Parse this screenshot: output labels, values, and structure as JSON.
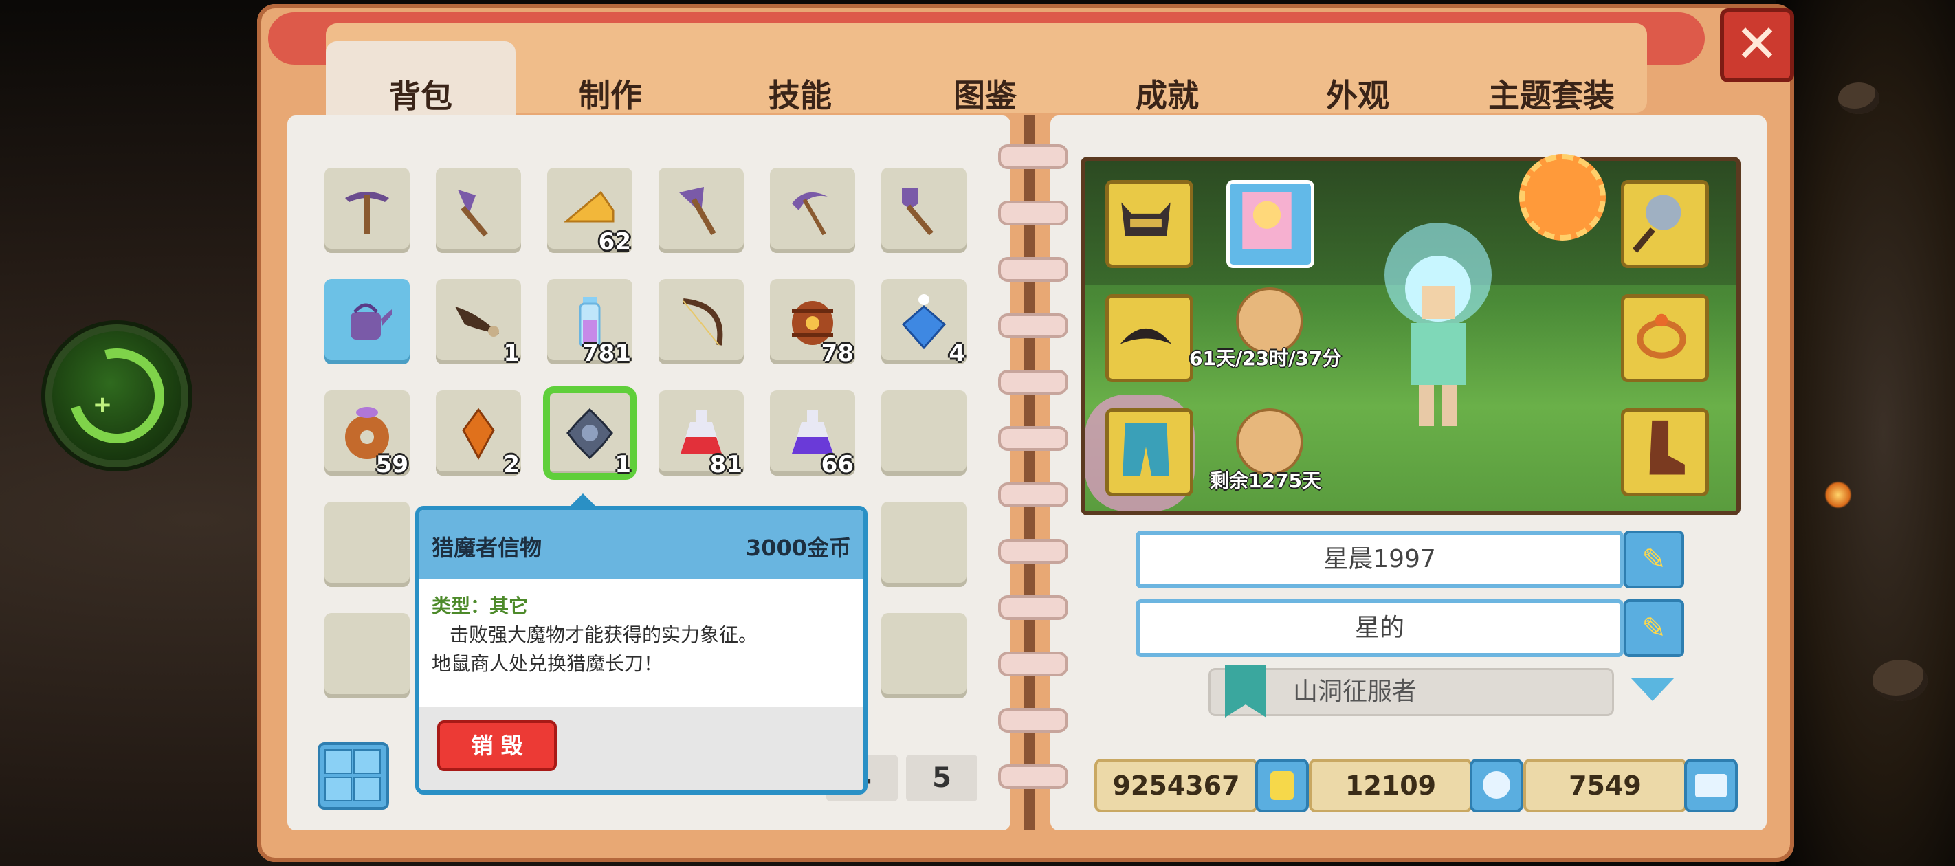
{
  "tabs": [
    "背包",
    "制作",
    "技能",
    "图鉴",
    "成就",
    "外观",
    "主题套装"
  ],
  "active_tab": "背包",
  "inventory": {
    "rows": [
      [
        {
          "icon": "pickaxe-icon",
          "qty": ""
        },
        {
          "icon": "hoe-icon",
          "qty": ""
        },
        {
          "icon": "cheese-icon",
          "qty": "62"
        },
        {
          "icon": "axe-icon",
          "qty": ""
        },
        {
          "icon": "scythe-icon",
          "qty": ""
        },
        {
          "icon": "shovel-icon",
          "qty": ""
        }
      ],
      [
        {
          "icon": "watering-can-icon",
          "qty": ""
        },
        {
          "icon": "bird-icon",
          "qty": "1"
        },
        {
          "icon": "glass-vial-icon",
          "qty": "781"
        },
        {
          "icon": "bow-icon",
          "qty": ""
        },
        {
          "icon": "barrel-icon",
          "qty": "78"
        },
        {
          "icon": "blue-gem-icon",
          "qty": "4"
        }
      ],
      [
        {
          "icon": "donut-icon",
          "qty": "59"
        },
        {
          "icon": "amber-crystal-icon",
          "qty": "2"
        },
        {
          "icon": "demon-hunter-token-icon",
          "qty": "1"
        },
        {
          "icon": "red-potion-icon",
          "qty": "81"
        },
        {
          "icon": "purple-potion-icon",
          "qty": "66"
        },
        {
          "icon": "",
          "qty": ""
        }
      ]
    ]
  },
  "tooltip": {
    "name": "猎魔者信物",
    "price": "3000金币",
    "type": "类型：其它",
    "desc1": "击败强大魔物才能获得的实力象征。",
    "desc2": "地鼠商人处兑换猎魔长刀！",
    "destroy": "销 毁"
  },
  "pages": [
    "4",
    "5"
  ],
  "character": {
    "timer1": "61天/23时/37分",
    "timer2": "剩余1275天",
    "name": "星晨1997",
    "guild": "星的",
    "title": "山洞征服者"
  },
  "currency": {
    "gold": "9254367",
    "gems": "12109",
    "tickets": "7549"
  }
}
